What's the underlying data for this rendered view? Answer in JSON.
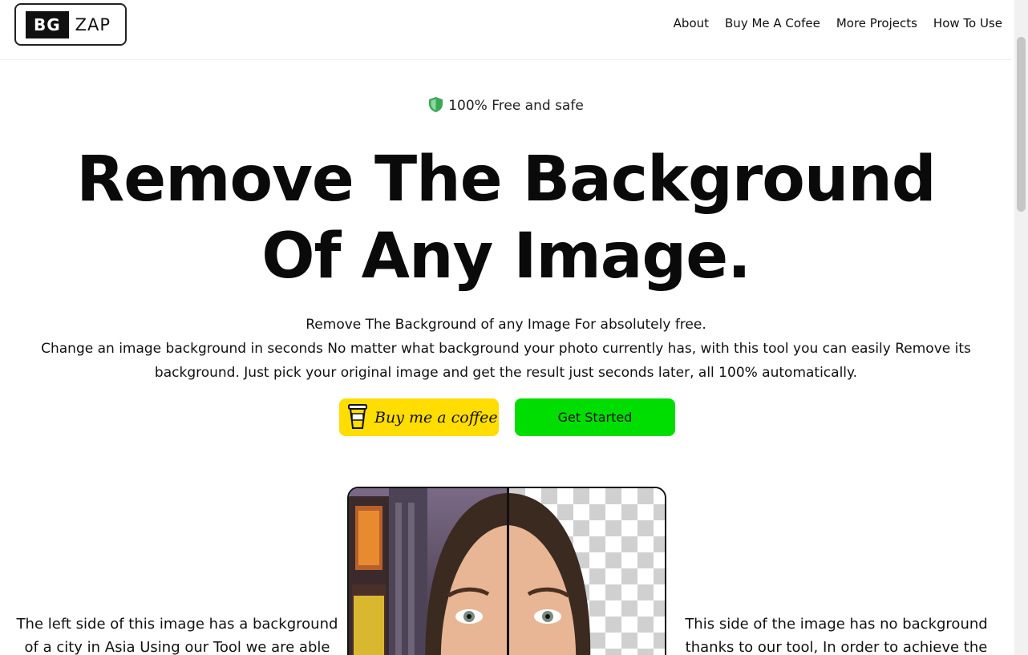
{
  "logo": {
    "box_text": "BG",
    "text": "ZAP"
  },
  "nav": {
    "items": [
      "About",
      "Buy Me A Cofee",
      "More Projects",
      "How To Use"
    ]
  },
  "hero": {
    "badge": "100% Free and safe",
    "title_line1": "Remove The Background",
    "title_line2": "Of Any Image.",
    "description_line1": "Remove The Background of any Image For absolutely free.",
    "description_line2": "Change an image background in seconds No matter what background your photo currently has, with this tool you can easily Remove its background. Just pick your original image and get the result just seconds later, all 100% automatically."
  },
  "buttons": {
    "coffee_label": "Buy me a coffee",
    "start_label": "Get Started"
  },
  "demo": {
    "left_caption": "The left side of this image has a background of a city in Asia Using our Tool we are able",
    "right_caption": "This side of the image has no background thanks to our tool, In order to achieve the"
  },
  "colors": {
    "badge_shield": "#3aa857",
    "coffee_button": "#ffdd00",
    "start_button": "#00dd00"
  },
  "icons": {
    "badge": "shield-icon",
    "coffee": "coffee-cup-icon"
  }
}
